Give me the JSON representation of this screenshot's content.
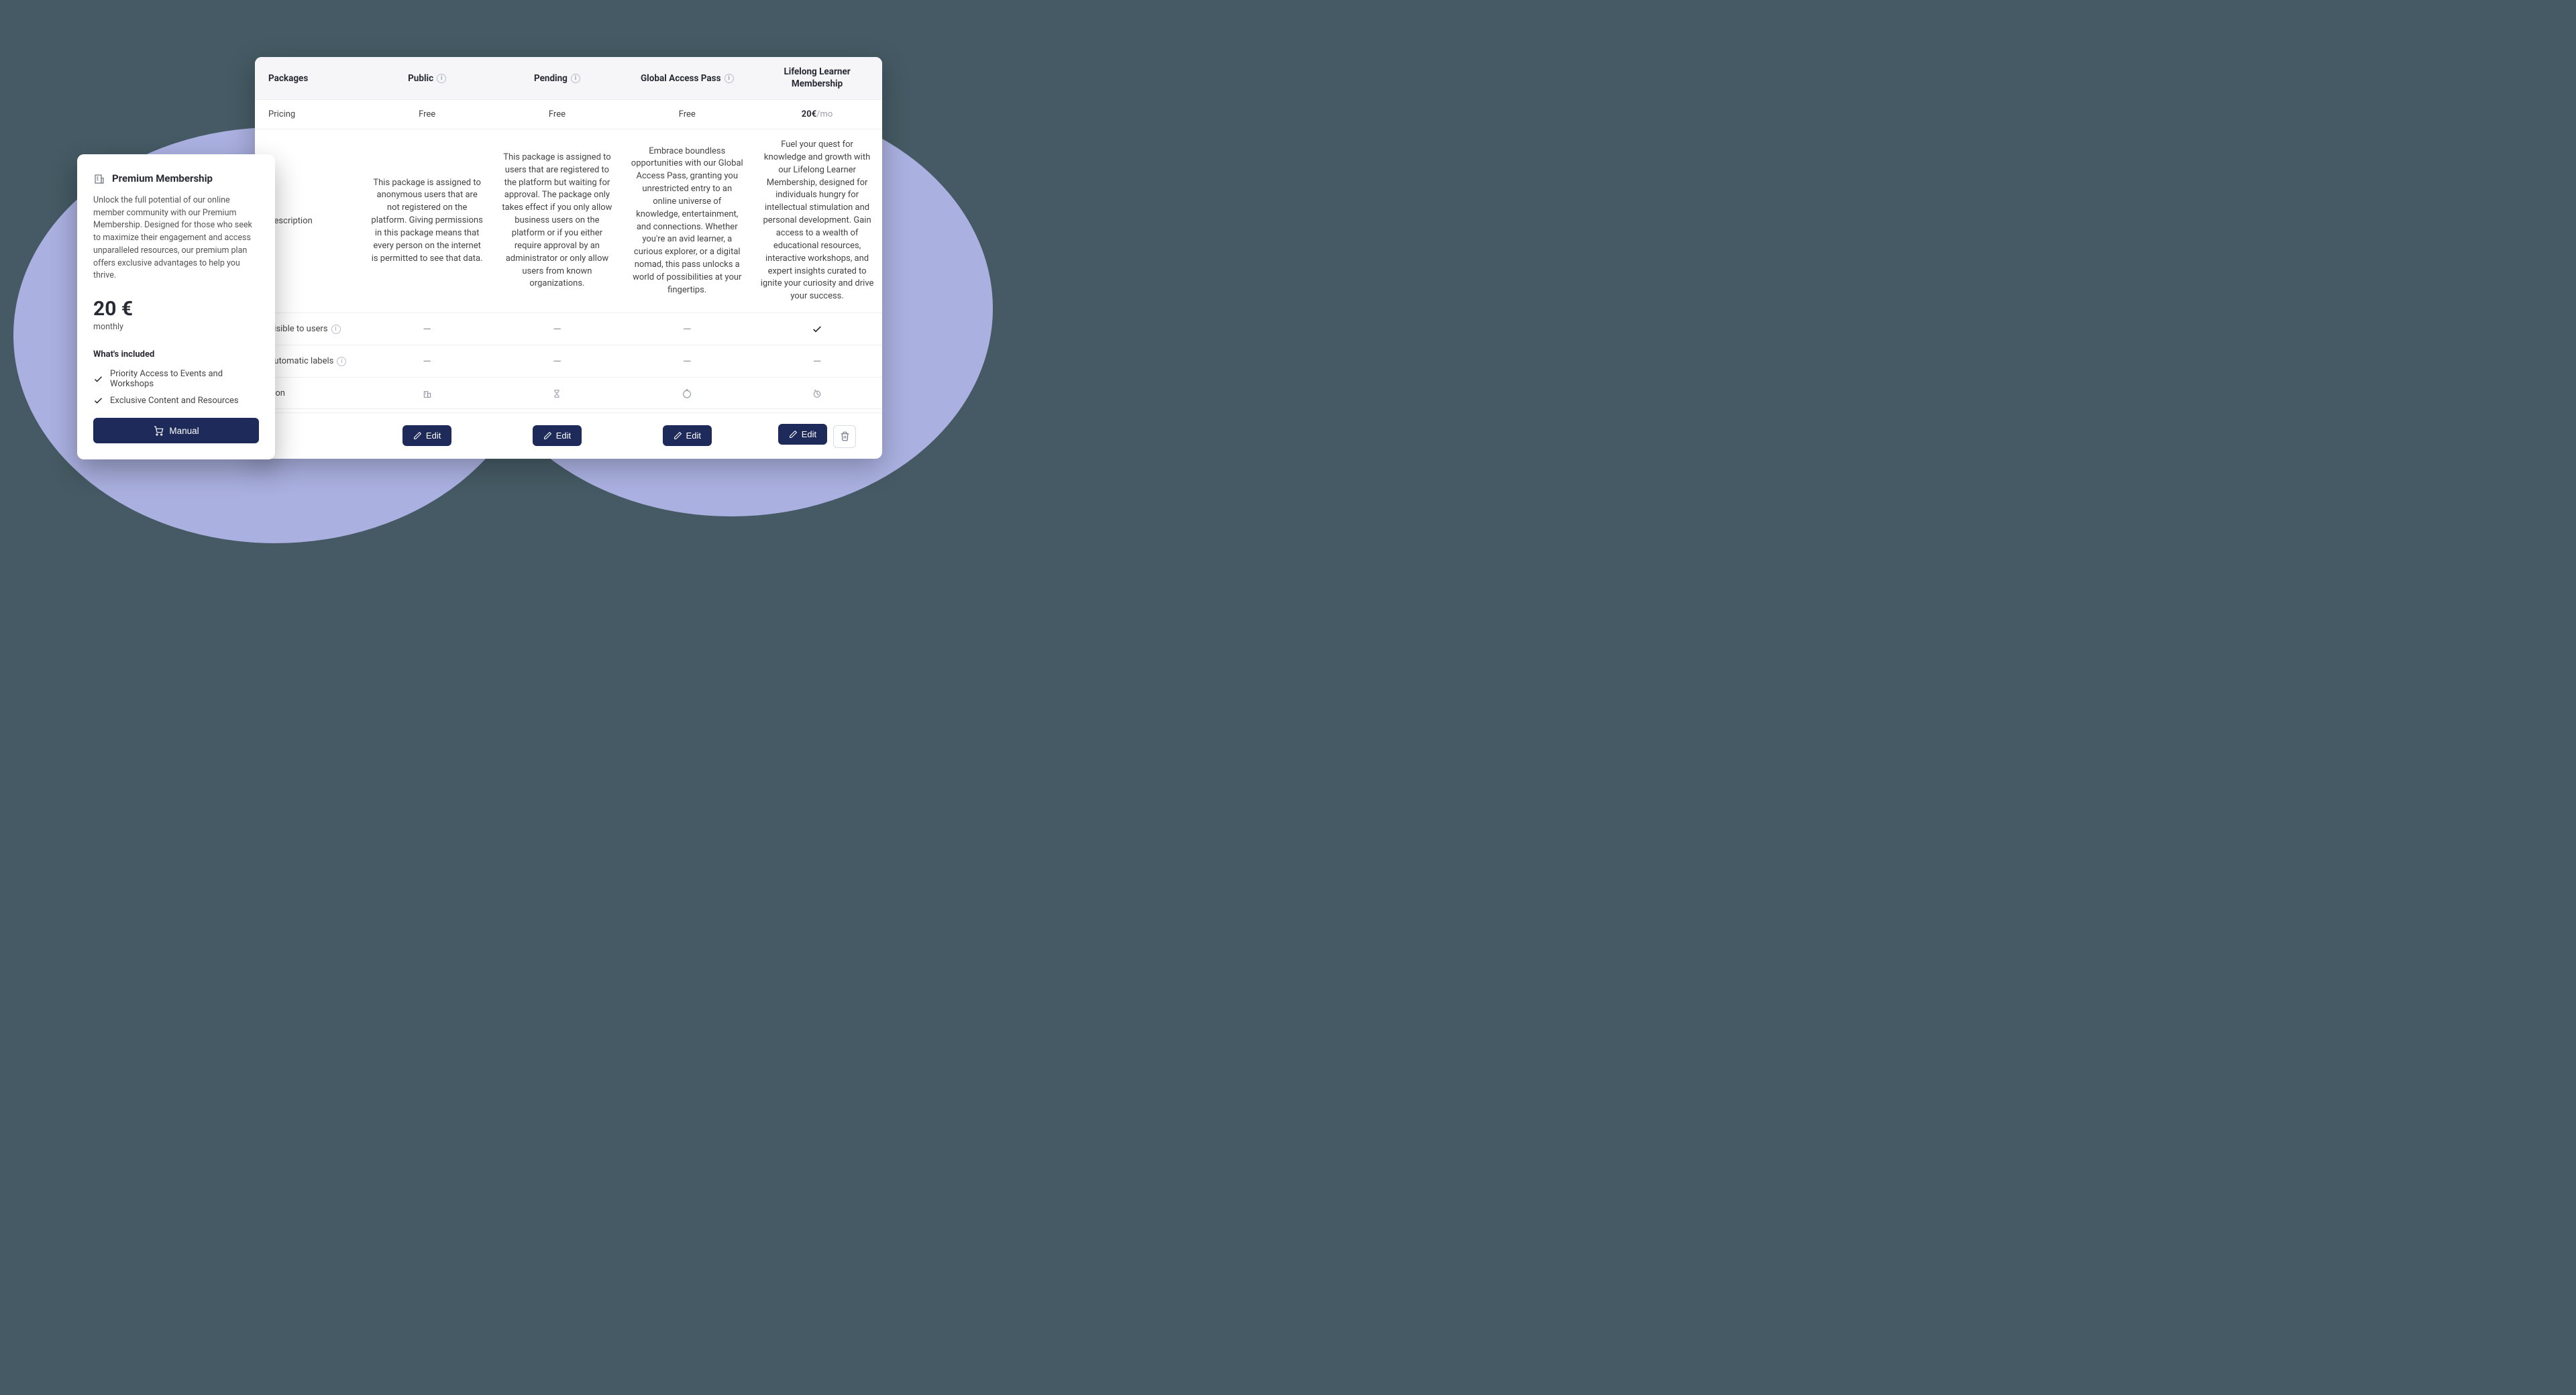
{
  "premium": {
    "title": "Premium Membership",
    "description": "Unlock the full potential of our online member community with our Premium Membership. Designed for those who seek to maximize their engagement and access unparalleled resources, our premium plan offers exclusive advantages to help you thrive.",
    "price": "20 €",
    "period": "monthly",
    "included_heading": "What's included",
    "features": [
      "Priority Access to Events and Workshops",
      "Exclusive Content and Resources"
    ],
    "manual_label": "Manual"
  },
  "table": {
    "header_packages": "Packages",
    "columns": [
      {
        "name": "Public",
        "has_info": true
      },
      {
        "name": "Pending",
        "has_info": true
      },
      {
        "name": "Global Access Pass",
        "has_info": true
      },
      {
        "name": "Lifelong Learner Membership",
        "has_info": false
      }
    ],
    "rows": {
      "pricing_label": "Pricing",
      "pricing": [
        "Free",
        "Free",
        "Free",
        {
          "price": "20€",
          "suffix": "/mo"
        }
      ],
      "description_label": "Description",
      "descriptions": [
        "This package is assigned to anonymous users that are not registered on the platform. Giving permissions in this package means that every person on the internet is permitted to see that data.",
        "This package is assigned to users that are registered to the platform but waiting for approval. The package only takes effect if you only allow business users on the platform or if you either require approval by an administrator or only allow users from known organizations.",
        "Embrace boundless opportunities with our Global Access Pass, granting you unrestricted entry to an online universe of knowledge, entertainment, and connections. Whether you're an avid learner, a curious explorer, or a digital nomad, this pass unlocks a world of possibilities at your fingertips.",
        "Fuel your quest for knowledge and growth with our Lifelong Learner Membership, designed for individuals hungry for intellectual stimulation and personal development. Gain access to a wealth of educational resources, interactive workshops, and expert insights curated to ignite your curiosity and drive your success."
      ],
      "visible_label": "Visible to users",
      "visible": [
        "dash",
        "dash",
        "dash",
        "check"
      ],
      "autolabels_label": "Automatic labels",
      "autolabels": [
        "dash",
        "dash",
        "dash",
        "dash"
      ],
      "icon_label": "Icon",
      "icons": [
        "building",
        "hourglass",
        "globe",
        "learner"
      ]
    },
    "edit_label": "Edit"
  }
}
